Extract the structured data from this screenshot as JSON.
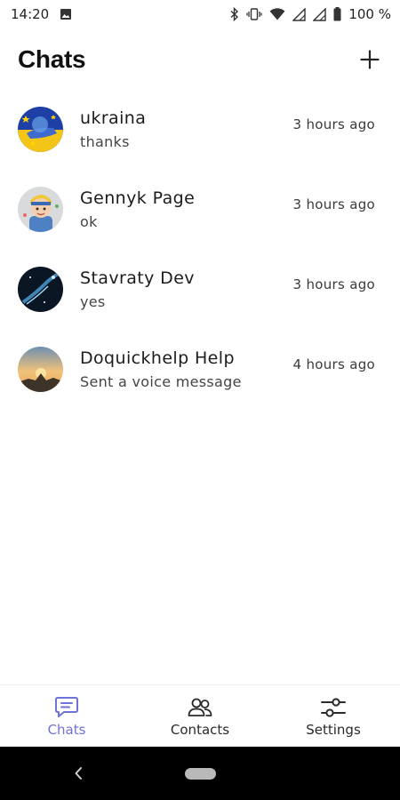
{
  "status_bar": {
    "time": "14:20",
    "battery": "100 %",
    "icons": [
      "image-icon",
      "bluetooth-icon",
      "vibrate-icon",
      "wifi-icon",
      "signal-icon",
      "signal-icon",
      "battery-icon"
    ]
  },
  "header": {
    "title": "Chats",
    "new_chat_icon": "plus-icon"
  },
  "chats": [
    {
      "name": "ukraina",
      "preview": "thanks",
      "time": "3 hours ago",
      "avatar": "avatar-ukraine"
    },
    {
      "name": "Gennyk Page",
      "preview": "ok",
      "time": "3 hours ago",
      "avatar": "avatar-cartoon-boy"
    },
    {
      "name": "Stavraty Dev",
      "preview": "yes",
      "time": "3 hours ago",
      "avatar": "avatar-space"
    },
    {
      "name": "Doquickhelp Help",
      "preview": "Sent a voice message",
      "time": "4 hours ago",
      "avatar": "avatar-sunset"
    }
  ],
  "tabs": [
    {
      "label": "Chats",
      "icon": "chat-bubble-icon",
      "active": true
    },
    {
      "label": "Contacts",
      "icon": "contacts-icon",
      "active": false
    },
    {
      "label": "Settings",
      "icon": "sliders-icon",
      "active": false
    }
  ],
  "colors": {
    "accent": "#6f72d6",
    "text": "#1a1a1a",
    "nav_bar": "#000000"
  }
}
